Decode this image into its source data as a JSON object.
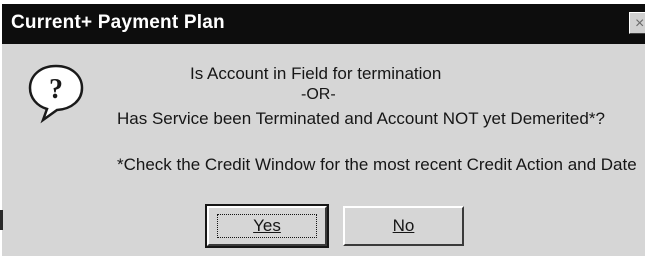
{
  "window": {
    "title": "Current+ Payment Plan",
    "close_glyph": "×"
  },
  "icon": {
    "name": "question-icon",
    "glyph": "?"
  },
  "message": {
    "line1": "Is Account in Field for termination",
    "line2": "-OR-",
    "line3": "Has Service been Terminated and Account NOT yet Demerited*?",
    "line4": "*Check the Credit Window for the most recent Credit Action and Date"
  },
  "buttons": {
    "yes_label": "Yes",
    "no_label": "No"
  },
  "colors": {
    "titlebar": "#0d0d0d",
    "dialog_face": "#d6d6d6",
    "text": "#161616"
  }
}
